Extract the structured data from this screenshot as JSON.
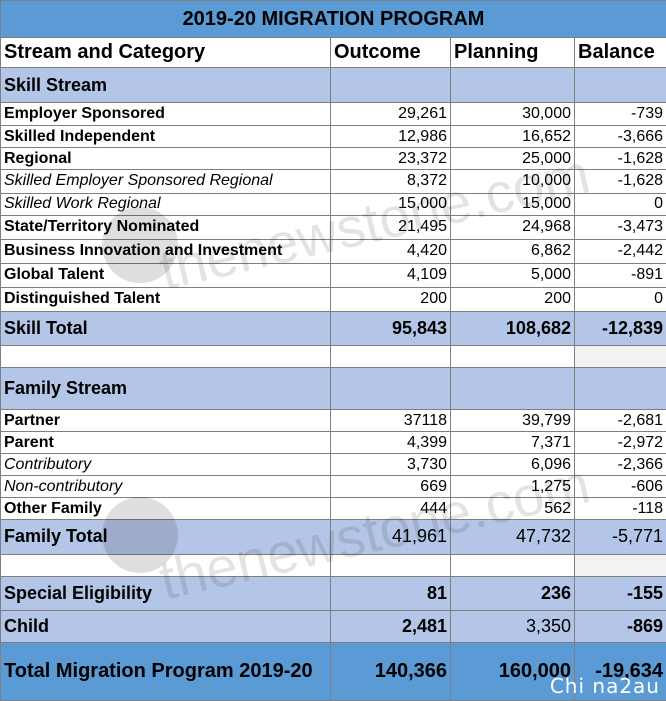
{
  "title": "2019-20 MIGRATION PROGRAM",
  "headers": {
    "category": "Stream and Category",
    "outcome": "Outcome",
    "planning": "Planning",
    "balance": "Balance"
  },
  "skill_stream": {
    "label": "Skill Stream",
    "rows": [
      {
        "name": "Employer Sponsored",
        "outcome": "29,261",
        "planning": "30,000",
        "balance": "-739"
      },
      {
        "name": "Skilled Independent",
        "outcome": "12,986",
        "planning": "16,652",
        "balance": "-3,666"
      },
      {
        "name": "Regional",
        "outcome": "23,372",
        "planning": "25,000",
        "balance": "-1,628"
      },
      {
        "name": "Skilled Employer Sponsored Regional",
        "outcome": "8,372",
        "planning": "10,000",
        "balance": "-1,628"
      },
      {
        "name": "Skilled Work Regional",
        "outcome": "15,000",
        "planning": "15,000",
        "balance": "0"
      },
      {
        "name": "State/Territory Nominated",
        "outcome": "21,495",
        "planning": "24,968",
        "balance": "-3,473"
      },
      {
        "name": "Business Innovation and Investment",
        "outcome": "4,420",
        "planning": "6,862",
        "balance": "-2,442"
      },
      {
        "name": "Global Talent",
        "outcome": "4,109",
        "planning": "5,000",
        "balance": "-891"
      },
      {
        "name": "Distinguished Talent",
        "outcome": "200",
        "planning": "200",
        "balance": "0"
      }
    ],
    "total": {
      "name": "Skill Total",
      "outcome": "95,843",
      "planning": "108,682",
      "balance": "-12,839"
    }
  },
  "family_stream": {
    "label": "Family Stream",
    "rows": [
      {
        "name": "Partner",
        "outcome": "37118",
        "planning": "39,799",
        "balance": "-2,681"
      },
      {
        "name": "Parent",
        "outcome": "4,399",
        "planning": "7,371",
        "balance": "-2,972"
      },
      {
        "name": "Contributory",
        "outcome": "3,730",
        "planning": "6,096",
        "balance": "-2,366"
      },
      {
        "name": "Non-contributory",
        "outcome": "669",
        "planning": "1,275",
        "balance": "-606"
      },
      {
        "name": "Other Family",
        "outcome": "444",
        "planning": "562",
        "balance": "-118"
      }
    ],
    "total": {
      "name": "Family Total",
      "outcome": "41,961",
      "planning": "47,732",
      "balance": "-5,771"
    }
  },
  "special_eligibility": {
    "name": "Special Eligibility",
    "outcome": "81",
    "planning": "236",
    "balance": "-155"
  },
  "child": {
    "name": "Child",
    "outcome": "2,481",
    "planning": "3,350",
    "balance": "-869"
  },
  "grand_total": {
    "name": "Total Migration Program 2019-20",
    "outcome": "140,366",
    "planning": "160,000",
    "balance": "-19,634"
  },
  "watermark": {
    "site_top": "thenewstone.com",
    "site_bottom": "thenewstone.com",
    "credit": "Chi na2au"
  }
}
